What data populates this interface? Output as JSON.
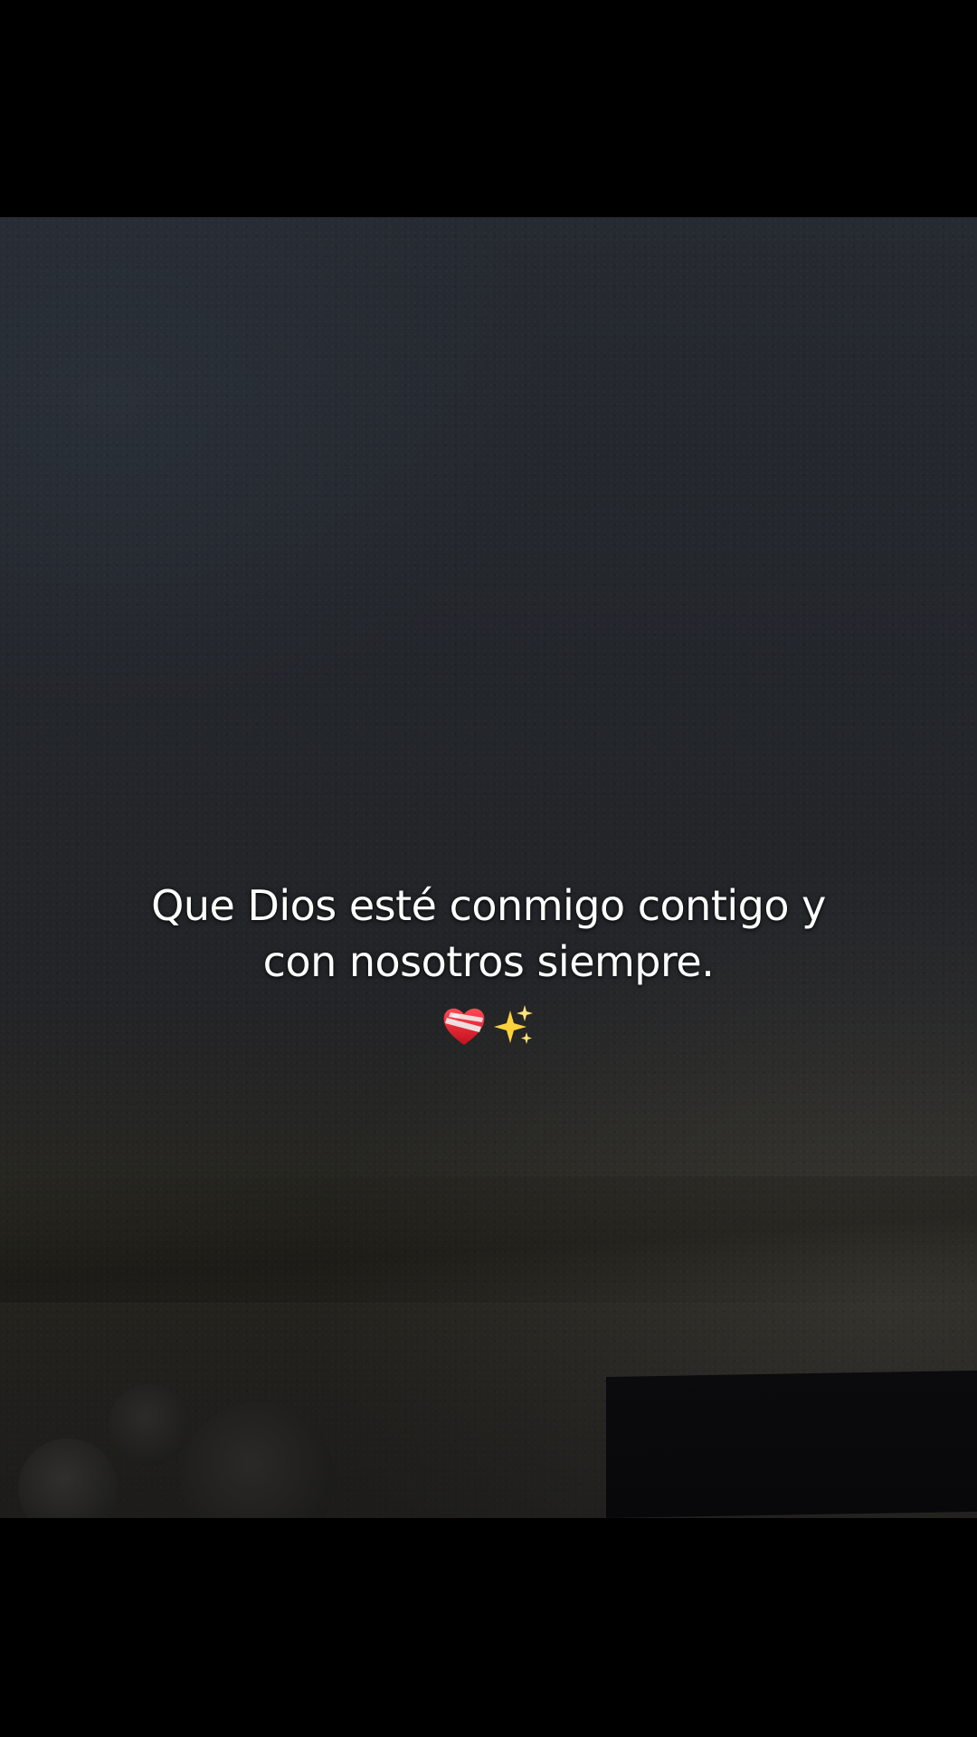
{
  "caption": {
    "line1": "Que Dios esté conmigo contigo y",
    "line2": "con nosotros siempre.",
    "emojis": [
      {
        "icon": "mending-heart-icon",
        "color": "#e8202e"
      },
      {
        "icon": "sparkles-icon",
        "color": "#ffd23c"
      }
    ]
  },
  "colors": {
    "letterbox": "#000000",
    "wall": "#24272c",
    "text": "#ffffff"
  }
}
